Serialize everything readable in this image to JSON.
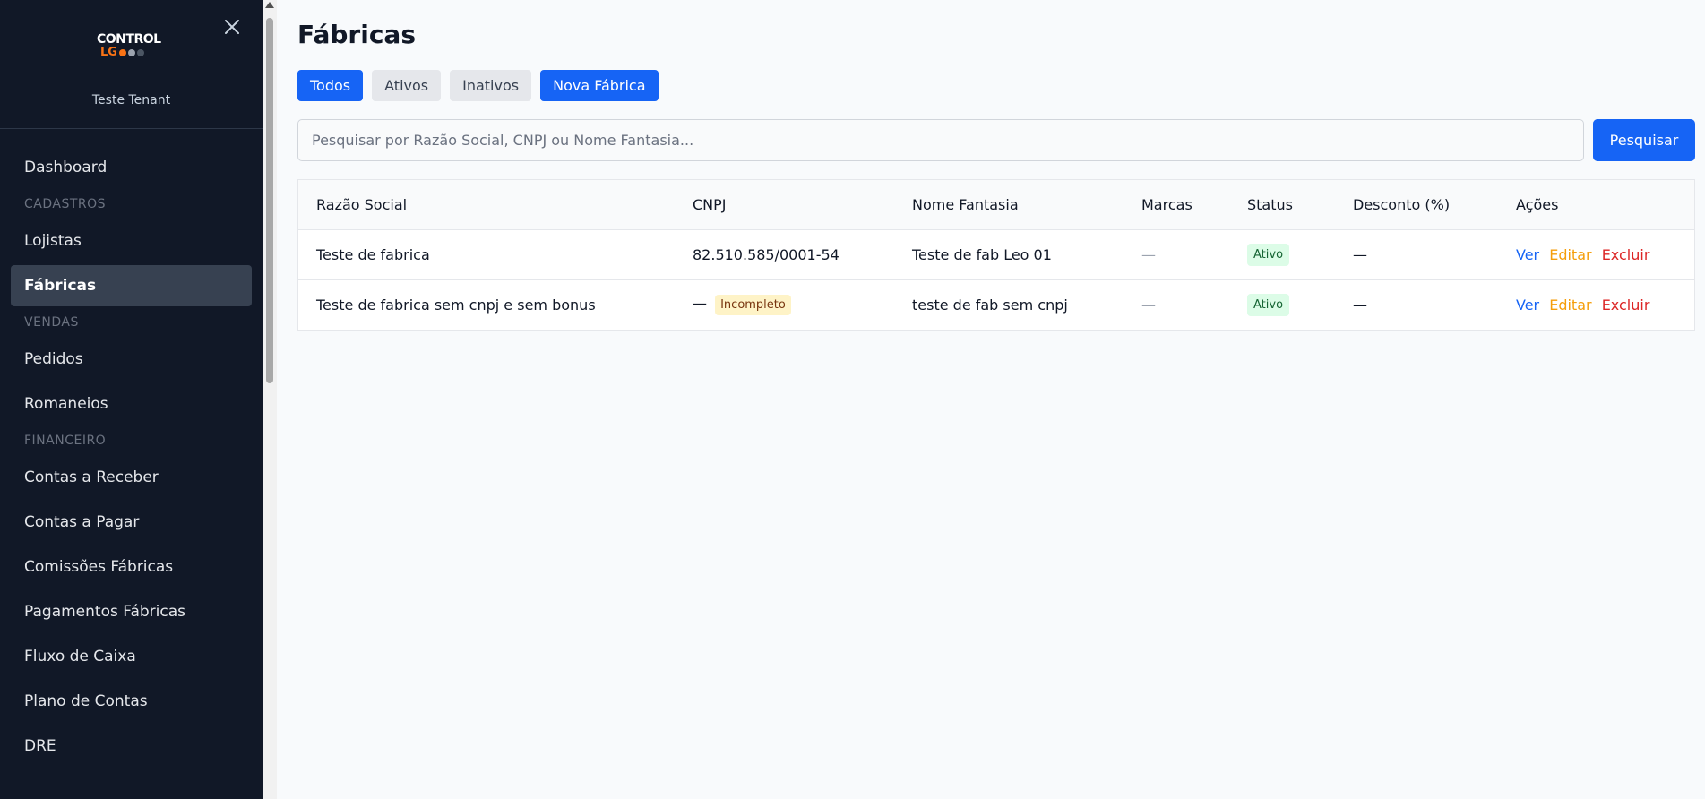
{
  "sidebar": {
    "logo_top": "CONTROL",
    "logo_bottom": "LG",
    "logo_dot_colors": [
      "#f97316",
      "#9ca3af",
      "#4b5563"
    ],
    "tenant": "Teste Tenant",
    "dashboard": "Dashboard",
    "sections": {
      "cadastros": "CADASTROS",
      "vendas": "VENDAS",
      "financeiro": "FINANCEIRO"
    },
    "items": {
      "lojistas": "Lojistas",
      "fabricas": "Fábricas",
      "pedidos": "Pedidos",
      "romaneios": "Romaneios",
      "contas_receber": "Contas a Receber",
      "contas_pagar": "Contas a Pagar",
      "comissoes": "Comissões Fábricas",
      "pagamentos": "Pagamentos Fábricas",
      "fluxo": "Fluxo de Caixa",
      "plano": "Plano de Contas",
      "dre": "DRE"
    },
    "close_icon": "close-icon"
  },
  "main": {
    "title": "Fábricas",
    "filters": {
      "todos": "Todos",
      "ativos": "Ativos",
      "inativos": "Inativos",
      "nova": "Nova Fábrica"
    },
    "search": {
      "placeholder": "Pesquisar por Razão Social, CNPJ ou Nome Fantasia...",
      "button": "Pesquisar"
    },
    "table": {
      "headers": {
        "razao": "Razão Social",
        "cnpj": "CNPJ",
        "fantasia": "Nome Fantasia",
        "marcas": "Marcas",
        "status": "Status",
        "desconto": "Desconto (%)",
        "acoes": "Ações"
      },
      "rows": [
        {
          "razao": "Teste de fabrica",
          "cnpj": "82.510.585/0001-54",
          "cnpj_badge": "",
          "fantasia": "Teste de fab Leo 01",
          "marcas": "—",
          "status": "Ativo",
          "desconto": "—"
        },
        {
          "razao": "Teste de fabrica sem cnpj e sem bonus",
          "cnpj": "—",
          "cnpj_badge": "Incompleto",
          "fantasia": "teste de fab sem cnpj",
          "marcas": "—",
          "status": "Ativo",
          "desconto": "—"
        }
      ],
      "actions": {
        "view": "Ver",
        "edit": "Editar",
        "delete": "Excluir"
      }
    }
  },
  "colors": {
    "primary": "#1664f5",
    "sidebar_bg": "#111827",
    "active_item_bg": "#374151",
    "success_bg": "#dcfce7",
    "warning_bg": "#fef3c7",
    "edit": "#f59e0b",
    "delete": "#dc2626"
  }
}
